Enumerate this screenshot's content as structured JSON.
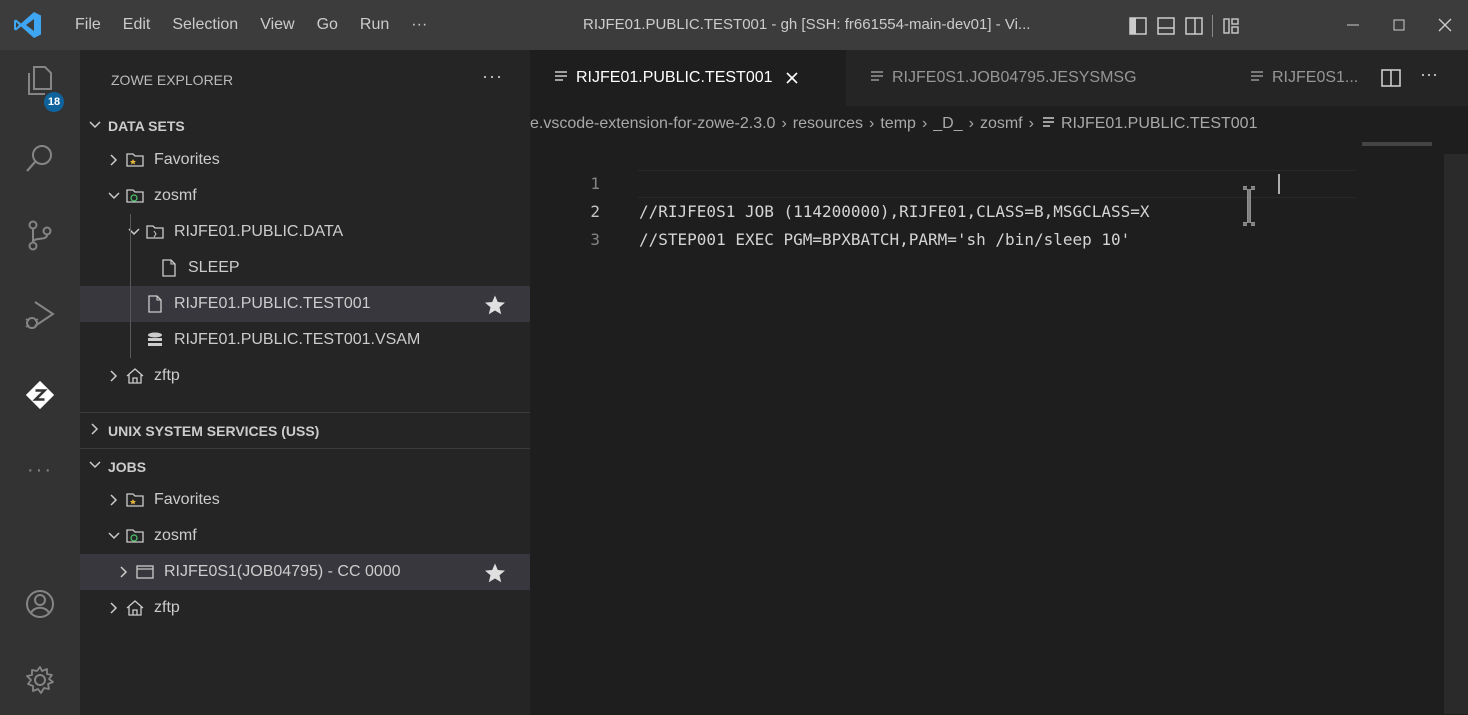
{
  "titlebar": {
    "menu": [
      "File",
      "Edit",
      "Selection",
      "View",
      "Go",
      "Run",
      "···"
    ],
    "window_title": "RIJFE01.PUBLIC.TEST001 - gh [SSH: fr661554-main-dev01] - Vi..."
  },
  "activitybar": {
    "explorer_badge": "18",
    "items": [
      "explorer-icon",
      "search-icon",
      "source-control-icon",
      "run-debug-icon",
      "zowe-icon",
      "more-icon",
      "account-icon",
      "manage-gear-icon"
    ],
    "more_label": "···"
  },
  "sidebar": {
    "title": "ZOWE EXPLORER",
    "more": "···",
    "data_sets": {
      "header": "DATA SETS",
      "favorites": "Favorites",
      "zosmf": "zosmf",
      "pds": "RIJFE01.PUBLIC.DATA",
      "member": "SLEEP",
      "seq": "RIJFE01.PUBLIC.TEST001",
      "vsam": "RIJFE01.PUBLIC.TEST001.VSAM",
      "zftp": "zftp"
    },
    "uss": {
      "header": "UNIX SYSTEM SERVICES (USS)"
    },
    "jobs": {
      "header": "JOBS",
      "favorites": "Favorites",
      "zosmf": "zosmf",
      "job": "RIJFE0S1(JOB04795) - CC 0000",
      "zftp": "zftp"
    }
  },
  "tabs": [
    {
      "label": "RIJFE01.PUBLIC.TEST001",
      "active": true,
      "close": "×"
    },
    {
      "label": "RIJFE0S1.JOB04795.JESYSMSG",
      "active": false
    },
    {
      "label": "RIJFE0S1...",
      "active": false
    }
  ],
  "tab_actions": {
    "more": "···"
  },
  "breadcrumbs": [
    "e.vscode-extension-for-zowe-2.3.0",
    "resources",
    "temp",
    "_D_",
    "zosmf",
    "RIJFE01.PUBLIC.TEST001"
  ],
  "editor": {
    "lines": [
      {
        "num": "1",
        "text": "//RIJFE0S1 JOB (114200000),RIJFE01,CLASS=B,MSGCLASS=X"
      },
      {
        "num": "2",
        "text": "//STEP001 EXEC PGM=BPXBATCH,PARM='sh /bin/sleep 10'"
      },
      {
        "num": "3",
        "text": ""
      }
    ],
    "current_line": 2
  },
  "colors": {
    "titlebar": "#3c3c3c",
    "activitybar": "#333333",
    "sidebar": "#252526",
    "editor": "#1e1e1e",
    "selection_row": "#37373d",
    "badge": "#0e639c",
    "logo_blue": "#3ea6f2"
  }
}
